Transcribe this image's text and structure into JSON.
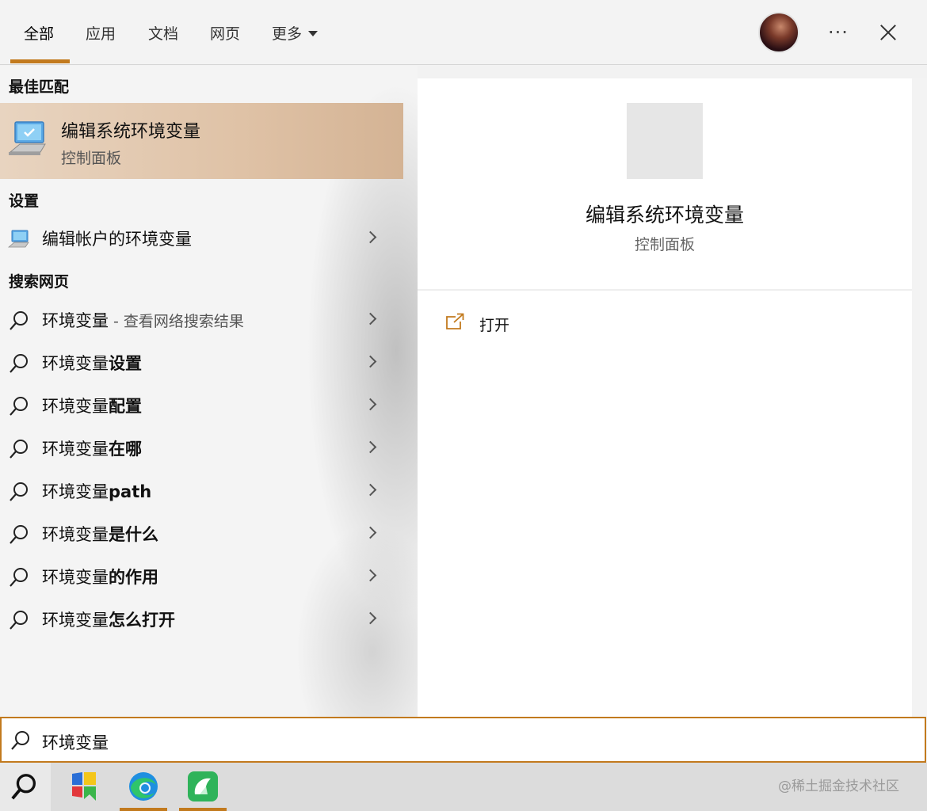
{
  "tabs": [
    {
      "label": "全部",
      "active": true
    },
    {
      "label": "应用",
      "active": false
    },
    {
      "label": "文档",
      "active": false
    },
    {
      "label": "网页",
      "active": false
    },
    {
      "label": "更多",
      "active": false
    }
  ],
  "header": {
    "more_options": "···",
    "icons": [
      "avatar",
      "more-icon",
      "close-icon"
    ]
  },
  "best_match": {
    "section_title": "最佳匹配",
    "title": "编辑系统环境变量",
    "subtitle": "控制面板",
    "icon": "system-properties-icon"
  },
  "settings": {
    "section_title": "设置",
    "items": [
      {
        "label": "编辑帐户的环境变量",
        "icon": "system-properties-icon"
      }
    ]
  },
  "web_search": {
    "section_title": "搜索网页",
    "items": [
      {
        "prefix": "环境变量",
        "suffix": "",
        "hint": " - 查看网络搜索结果"
      },
      {
        "prefix": "环境变量",
        "suffix": "设置",
        "hint": ""
      },
      {
        "prefix": "环境变量",
        "suffix": "配置",
        "hint": ""
      },
      {
        "prefix": "环境变量",
        "suffix": "在哪",
        "hint": ""
      },
      {
        "prefix": "环境变量",
        "suffix": "path",
        "hint": ""
      },
      {
        "prefix": "环境变量",
        "suffix": "是什么",
        "hint": ""
      },
      {
        "prefix": "环境变量",
        "suffix": "的作用",
        "hint": ""
      },
      {
        "prefix": "环境变量",
        "suffix": "怎么打开",
        "hint": ""
      }
    ]
  },
  "preview": {
    "title": "编辑系统环境变量",
    "subtitle": "控制面板",
    "actions": [
      {
        "label": "打开",
        "icon": "open-external-icon"
      }
    ]
  },
  "search": {
    "value": "环境变量"
  },
  "taskbar": {
    "apps": [
      {
        "name": "search",
        "active": false
      },
      {
        "name": "windows-app-icon",
        "active": false
      },
      {
        "name": "edge-icon",
        "active": true
      },
      {
        "name": "green-app-icon",
        "active": true
      }
    ],
    "watermark": "@稀土掘金技术社区"
  },
  "colors": {
    "accent": "#c27a1e",
    "best_match_bg": "#dfc2a6",
    "edge_blue": "#1f8fe0",
    "app_green": "#2fb35a"
  }
}
